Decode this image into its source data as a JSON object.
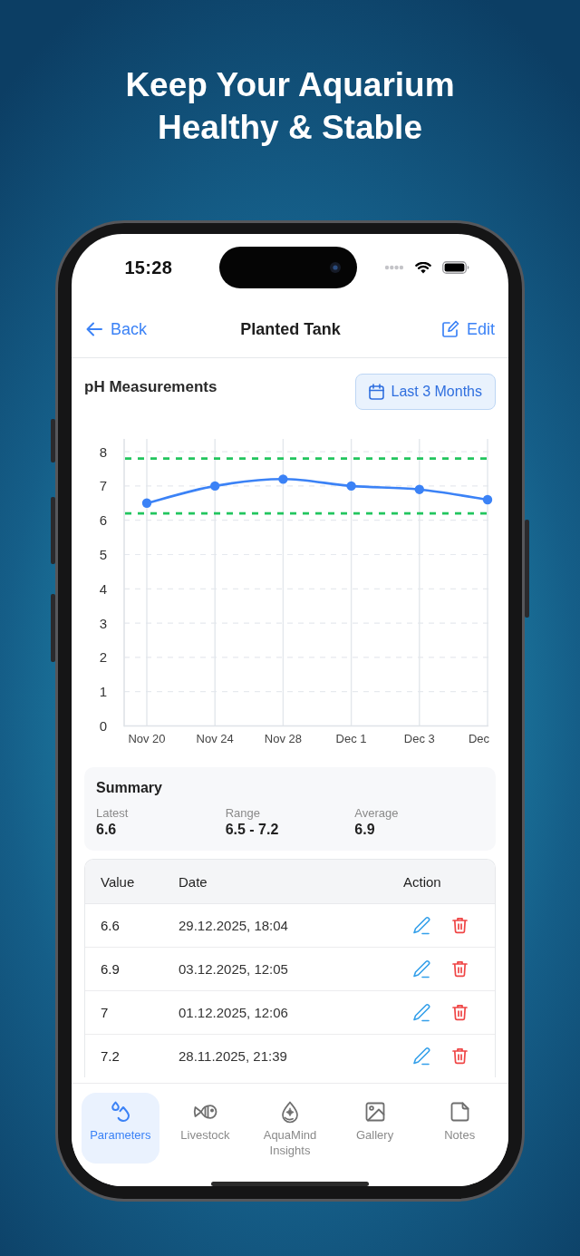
{
  "headline": "Keep Your Aquarium Healthy & Stable",
  "status_bar": {
    "time": "15:28"
  },
  "nav": {
    "back": "Back",
    "title": "Planted Tank",
    "edit": "Edit"
  },
  "chart_panel": {
    "title": "pH Measurements",
    "range_button": "Last 3 Months",
    "chart_data": {
      "type": "line",
      "categories": [
        "Nov 20",
        "Nov 24",
        "Nov 28",
        "Dec 1",
        "Dec 3",
        "Dec"
      ],
      "values": [
        6.5,
        7,
        7.2,
        7,
        6.9,
        6.6
      ],
      "ylim": [
        0,
        8
      ],
      "yticks": [
        0,
        1,
        2,
        3,
        4,
        5,
        6,
        7,
        8
      ],
      "grid": true,
      "marker": true,
      "ref_lines": [
        {
          "axis": "y",
          "value": 7.8
        },
        {
          "axis": "y",
          "value": 6.2
        }
      ]
    }
  },
  "summary": {
    "title": "Summary",
    "stats": [
      {
        "label": "Latest",
        "value": "6.6"
      },
      {
        "label": "Range",
        "value": "6.5 - 7.2"
      },
      {
        "label": "Average",
        "value": "6.9"
      }
    ]
  },
  "table": {
    "columns": [
      "Value",
      "Date",
      "Action"
    ],
    "rows": [
      {
        "value": "6.6",
        "date": "29.12.2025, 18:04"
      },
      {
        "value": "6.9",
        "date": "03.12.2025, 12:05"
      },
      {
        "value": "7",
        "date": "01.12.2025, 12:06"
      },
      {
        "value": "7.2",
        "date": "28.11.2025, 21:39"
      }
    ]
  },
  "tab_bar": {
    "tabs": [
      {
        "label": "Parameters",
        "selected": true
      },
      {
        "label": "Livestock",
        "selected": false
      },
      {
        "label": "AquaMind Insights",
        "selected": false
      },
      {
        "label": "Gallery",
        "selected": false
      },
      {
        "label": "Notes",
        "selected": false
      }
    ]
  }
}
